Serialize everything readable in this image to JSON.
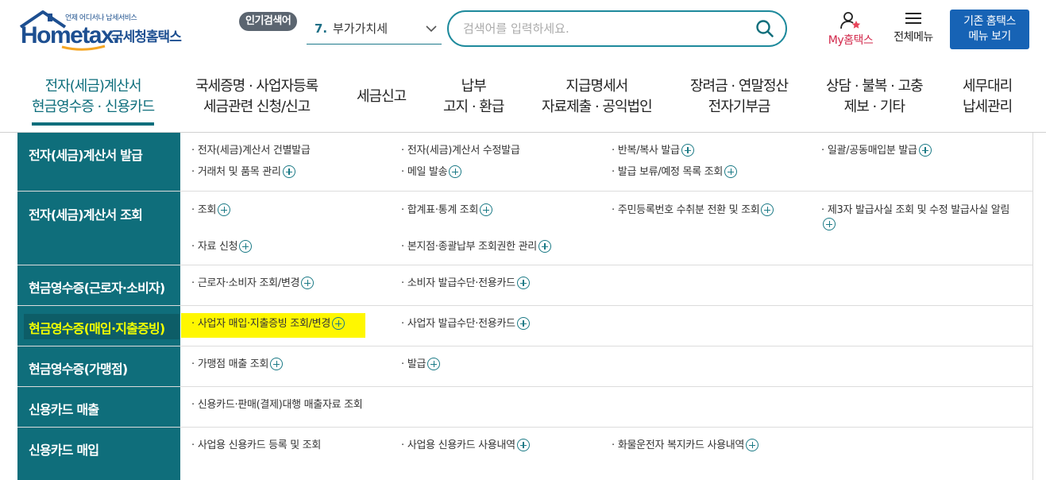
{
  "header": {
    "logo": {
      "sub": "언제 어디서나 납세서비스",
      "brand": "Hometax.",
      "name": "국세청홈택스"
    },
    "popular_badge": "인기검색어",
    "popular": {
      "rank": "7.",
      "term": "부가가치세"
    },
    "search": {
      "placeholder": "검색어를 입력하세요."
    },
    "my_hometax": "My홈택스",
    "all_menu": "전체메뉴",
    "legacy_button": {
      "line1": "기존 홈택스",
      "line2": "메뉴 보기"
    }
  },
  "gnb": [
    {
      "line1": "전자(세금)계산서",
      "line2": "현금영수증 · 신용카드"
    },
    {
      "line1": "국세증명 · 사업자등록",
      "line2": "세금관련 신청/신고"
    },
    {
      "line1": "세금신고",
      "line2": ""
    },
    {
      "line1": "납부",
      "line2": "고지 · 환급"
    },
    {
      "line1": "지급명세서",
      "line2": "자료제출 · 공익법인"
    },
    {
      "line1": "장려금 · 연말정산",
      "line2": "전자기부금"
    },
    {
      "line1": "상담 · 불복 · 고충",
      "line2": "제보 · 기타"
    },
    {
      "line1": "세무대리",
      "line2": "납세관리"
    }
  ],
  "sections": [
    {
      "title": "전자(세금)계산서 발급",
      "links": [
        "전자(세금)계산서 건별발급",
        "전자(세금)계산서 수정발급",
        "반복/복사 발급",
        "일괄/공동매입분 발급",
        "거래처 및 품목 관리",
        "메일 발송",
        "발급 보류/예정 목록 조회"
      ]
    },
    {
      "title": "전자(세금)계산서 조회",
      "links": [
        "조회",
        "합계표·통계 조회",
        "주민등록번호 수취분 전환 및 조회",
        "제3자 발급사실 조회 및 수정 발급사실 알림",
        "자료 신청",
        "본지점·종괄납부 조회권한 관리"
      ]
    },
    {
      "title": "현금영수증(근로자·소비자)",
      "links": [
        "근로자·소비자 조회/변경",
        "소비자 발급수단·전용카드"
      ]
    },
    {
      "title": "현금영수증(매입·지출증빙)",
      "links": [
        "사업자 매입·지출증빙 조회/변경",
        "사업자 발급수단·전용카드"
      ]
    },
    {
      "title": "현금영수증(가맹점)",
      "links": [
        "가맹점 매출 조회",
        "발급"
      ]
    },
    {
      "title": "신용카드 매출",
      "links": [
        "신용카드·판매(결제)대행 매출자료 조회"
      ]
    },
    {
      "title": "신용카드 매입",
      "links": [
        "사업용 신용카드 등록 및 조회",
        "사업용 신용카드 사용내역",
        "화물운전자 복지카드 사용내역"
      ]
    }
  ],
  "colors": {
    "primary": "#0f6e7b",
    "highlight": "#fff700",
    "highlight_text": "#f2ff00",
    "brand_blue": "#1d4f91",
    "my_red": "#d2284b",
    "legacy_button_bg": "#1763b5"
  }
}
